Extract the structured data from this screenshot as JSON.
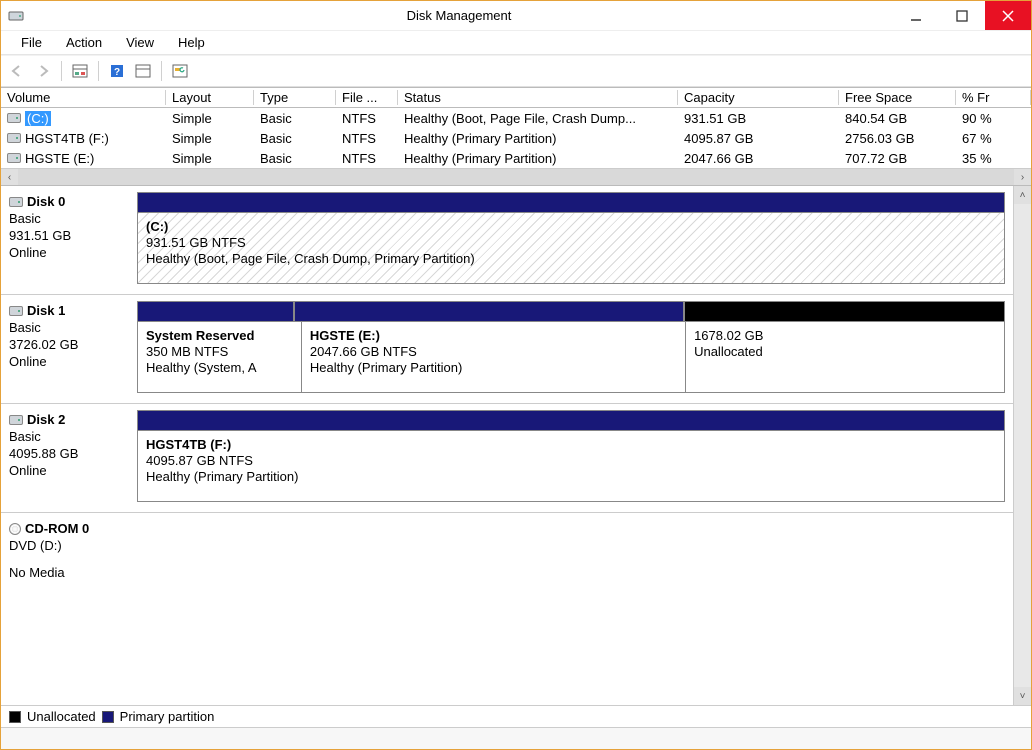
{
  "window": {
    "title": "Disk Management"
  },
  "menu": {
    "file": "File",
    "action": "Action",
    "view": "View",
    "help": "Help"
  },
  "columns": {
    "volume": "Volume",
    "layout": "Layout",
    "type": "Type",
    "fs": "File ...",
    "status": "Status",
    "capacity": "Capacity",
    "free": "Free Space",
    "pct": "% Fr"
  },
  "rows": [
    {
      "volume": "(C:)",
      "layout": "Simple",
      "type": "Basic",
      "fs": "NTFS",
      "status": "Healthy (Boot, Page File, Crash Dump...",
      "capacity": "931.51 GB",
      "free": "840.54 GB",
      "pct": "90 %",
      "selected": true
    },
    {
      "volume": "HGST4TB (F:)",
      "layout": "Simple",
      "type": "Basic",
      "fs": "NTFS",
      "status": "Healthy (Primary Partition)",
      "capacity": "4095.87 GB",
      "free": "2756.03 GB",
      "pct": "67 %"
    },
    {
      "volume": "HGSTE (E:)",
      "layout": "Simple",
      "type": "Basic",
      "fs": "NTFS",
      "status": "Healthy (Primary Partition)",
      "capacity": "2047.66 GB",
      "free": "707.72 GB",
      "pct": "35 %"
    }
  ],
  "disks": [
    {
      "name": "Disk 0",
      "type": "Basic",
      "size": "931.51 GB",
      "state": "Online",
      "partitions": [
        {
          "label": "(C:)",
          "size": "931.51 GB NTFS",
          "status": "Healthy (Boot, Page File, Crash Dump, Primary Partition)",
          "color": "navy",
          "hatched": true,
          "flex": 1
        }
      ]
    },
    {
      "name": "Disk 1",
      "type": "Basic",
      "size": "3726.02 GB",
      "state": "Online",
      "partitions": [
        {
          "label": "System Reserved",
          "size": "350 MB NTFS",
          "status": "Healthy (System, A",
          "color": "navy",
          "flex": 0.18
        },
        {
          "label": "HGSTE  (E:)",
          "size": "2047.66 GB NTFS",
          "status": "Healthy (Primary Partition)",
          "color": "navy",
          "flex": 0.45
        },
        {
          "label": "",
          "size": "1678.02 GB",
          "status": "Unallocated",
          "color": "black",
          "flex": 0.37
        }
      ]
    },
    {
      "name": "Disk 2",
      "type": "Basic",
      "size": "4095.88 GB",
      "state": "Online",
      "partitions": [
        {
          "label": "HGST4TB  (F:)",
          "size": "4095.87 GB NTFS",
          "status": "Healthy (Primary Partition)",
          "color": "navy",
          "flex": 1
        }
      ]
    }
  ],
  "cdrom": {
    "name": "CD-ROM 0",
    "type": "DVD (D:)",
    "state": "No Media"
  },
  "legend": {
    "unallocated": "Unallocated",
    "primary": "Primary partition"
  }
}
